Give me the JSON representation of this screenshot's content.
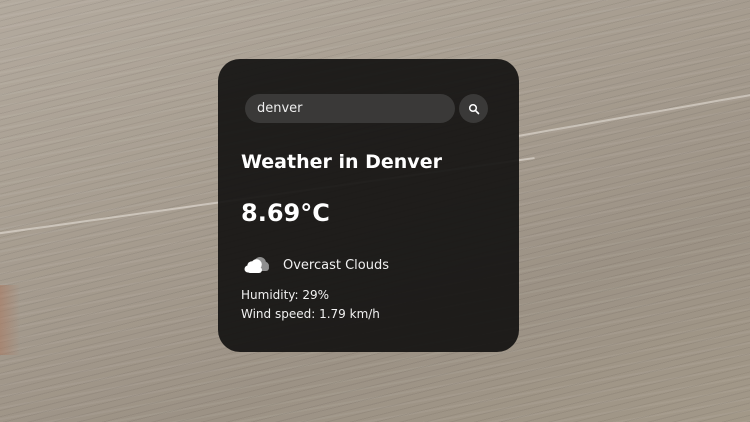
{
  "search": {
    "value": "denver",
    "icon": "search-icon"
  },
  "weather": {
    "title": "Weather in Denver",
    "temperature": "8.69°C",
    "description": "Overcast Clouds",
    "condition_icon": "cloud-icon",
    "humidity": "Humidity: 29%",
    "wind": "Wind speed: 1.79 km/h"
  },
  "colors": {
    "card_background": "#141312",
    "input_background": "#3a3938",
    "text": "#f2f2f2"
  }
}
